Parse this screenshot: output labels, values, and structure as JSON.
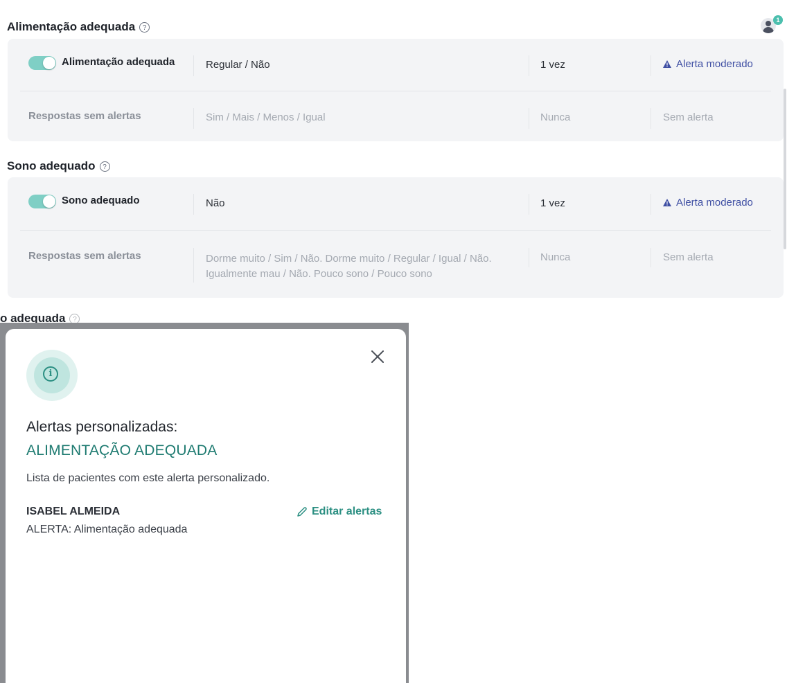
{
  "header": {
    "notification_count": "1"
  },
  "sections": [
    {
      "title": "Alimentação adequada",
      "help": "?",
      "alert_row": {
        "toggle_label": "Alimentação adequada",
        "answers": "Regular / Não",
        "frequency": "1 vez",
        "alert": "Alerta moderado"
      },
      "no_alert_row": {
        "label": "Respostas sem alertas",
        "answers": "Sim / Mais / Menos / Igual",
        "frequency": "Nunca",
        "alert": "Sem alerta"
      }
    },
    {
      "title": "Sono adequado",
      "help": "?",
      "alert_row": {
        "toggle_label": "Sono adequado",
        "answers": "Não",
        "frequency": "1 vez",
        "alert": "Alerta moderado"
      },
      "no_alert_row": {
        "label": "Respostas sem alertas",
        "answers_line1": "Dorme muito / Sim / Não. Dorme muito / Regular / Igual / Não.",
        "answers_line2": "Igualmente mau / Não. Pouco sono / Pouco sono",
        "frequency": "Nunca",
        "alert": "Sem alerta"
      }
    }
  ],
  "background_peek": {
    "title": "o adequada"
  },
  "modal": {
    "title": "Alertas personalizadas:",
    "subtitle": "ALIMENTAÇÃO ADEQUADA",
    "description": "Lista de pacientes com este alerta personalizado.",
    "patient": {
      "name": "ISABEL ALMEIDA",
      "alert": "ALERTA: Alimentação adequada"
    },
    "edit_label": "Editar alertas"
  },
  "colors": {
    "accent": "#2b8f82",
    "toggle_on": "#7fcfc5",
    "alert_link": "#3f4fa3",
    "panel_bg": "#f3f4f6"
  }
}
